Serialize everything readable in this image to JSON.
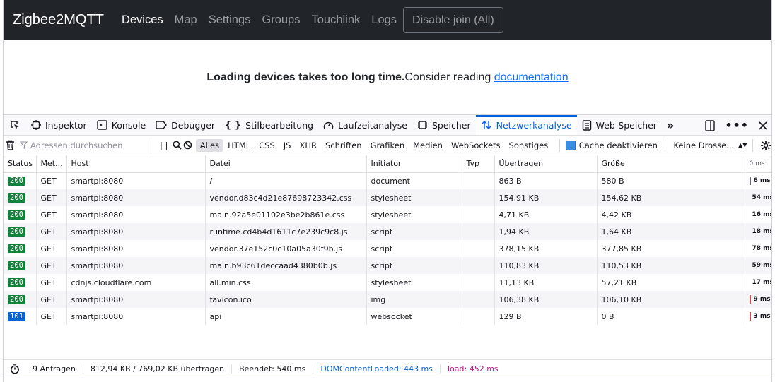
{
  "navbar": {
    "brand": "Zigbee2MQTT",
    "links": [
      "Devices",
      "Map",
      "Settings",
      "Groups",
      "Touchlink",
      "Logs"
    ],
    "join_button": "Disable join (All)"
  },
  "page": {
    "message_bold": "Loading devices takes too long time.",
    "message_text": "Consider reading ",
    "link_text": "documentation"
  },
  "devtools": {
    "tabs": [
      "Inspektor",
      "Konsole",
      "Debugger",
      "Stilbearbeitung",
      "Laufzeitanalyse",
      "Speicher",
      "Netzwerkanalyse",
      "Web-Speicher"
    ],
    "active_tab": "Netzwerkanalyse",
    "accent": "#0061e0",
    "toolbar": {
      "filter_placeholder": "Adressen durchsuchen",
      "pause_label": "| |",
      "types": [
        "Alles",
        "HTML",
        "CSS",
        "JS",
        "XHR",
        "Schriften",
        "Grafiken",
        "Medien",
        "WebSockets",
        "Sonstiges"
      ],
      "cache_label": "Cache deaktivieren",
      "throttle_label": "Keine Drosse..."
    },
    "columns": [
      "Status",
      "Met...",
      "Host",
      "Datei",
      "Initiator",
      "Typ",
      "Übertragen",
      "Größe",
      "0 ms"
    ],
    "rows": [
      {
        "status": "200",
        "method": "GET",
        "host": "smartpi:8080",
        "file": "/",
        "initiator": "document",
        "type": "",
        "transferred": "863 B",
        "size": "580 B",
        "time": "6 ms",
        "bar_color": "#6a6a75"
      },
      {
        "status": "200",
        "method": "GET",
        "host": "smartpi:8080",
        "file": "vendor.d83c4d21e87698723342.css",
        "initiator": "stylesheet",
        "type": "",
        "transferred": "154,91 KB",
        "size": "154,62 KB",
        "time": "54 ms",
        "bar_color": "#2fa84f"
      },
      {
        "status": "200",
        "method": "GET",
        "host": "smartpi:8080",
        "file": "main.92a5e01102e3be2b861e.css",
        "initiator": "stylesheet",
        "type": "",
        "transferred": "4,71 KB",
        "size": "4,42 KB",
        "time": "16 ms",
        "bar_color": "#c94f4f"
      },
      {
        "status": "200",
        "method": "GET",
        "host": "smartpi:8080",
        "file": "runtime.cd4b4d1611c7e239c9c8.js",
        "initiator": "script",
        "type": "",
        "transferred": "1,94 KB",
        "size": "1,64 KB",
        "time": "18 ms",
        "bar_color": "#c94f4f"
      },
      {
        "status": "200",
        "method": "GET",
        "host": "smartpi:8080",
        "file": "vendor.37e152c0c10a05a30f9b.js",
        "initiator": "script",
        "type": "",
        "transferred": "378,15 KB",
        "size": "377,85 KB",
        "time": "78 ms",
        "bar_color": "#2fa84f"
      },
      {
        "status": "200",
        "method": "GET",
        "host": "smartpi:8080",
        "file": "main.b93c61deccaad4380b0b.js",
        "initiator": "script",
        "type": "",
        "transferred": "110,83 KB",
        "size": "110,53 KB",
        "time": "59 ms",
        "bar_color": "#2fa84f"
      },
      {
        "status": "200",
        "method": "GET",
        "host": "cdnjs.cloudflare.com",
        "file": "all.min.css",
        "initiator": "stylesheet",
        "type": "",
        "transferred": "11,13 KB",
        "size": "57,21 KB",
        "time": "17 ms",
        "bar_color": "#2fa84f"
      },
      {
        "status": "200",
        "method": "GET",
        "host": "smartpi:8080",
        "file": "favicon.ico",
        "initiator": "img",
        "type": "",
        "transferred": "106,38 KB",
        "size": "106,10 KB",
        "time": "9 ms",
        "bar_color": "#c94f4f"
      },
      {
        "status": "101",
        "method": "GET",
        "host": "smartpi:8080",
        "file": "api",
        "initiator": "websocket",
        "type": "",
        "transferred": "129 B",
        "size": "0 B",
        "time": "3 ms",
        "bar_color": "#c94f4f"
      }
    ],
    "statusbar": {
      "requests": "9 Anfragen",
      "transferred": "812,94 KB / 769,02 KB übertragen",
      "finished": "Beendet: 540 ms",
      "dom_loaded": "DOMContentLoaded: 443 ms",
      "load": "load: 452 ms",
      "dom_color": "#0b64d4",
      "load_color": "#c4148e"
    }
  }
}
